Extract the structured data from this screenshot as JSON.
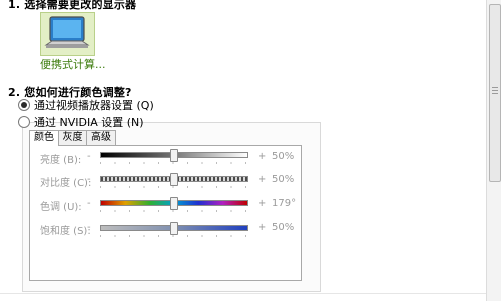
{
  "step1": {
    "label": "1. 选择需要更改的显示器"
  },
  "display": {
    "caption": "便携式计算..."
  },
  "step2": {
    "label": "2. 您如何进行颜色调整?"
  },
  "radios": [
    {
      "label": "通过视频播放器设置 (Q)",
      "checked": true
    },
    {
      "label": "通过 NVIDIA 设置 (N)",
      "checked": false
    }
  ],
  "tabs": [
    "颜色",
    "灰度",
    "高级"
  ],
  "sliders": [
    {
      "label": "亮度 (B):",
      "minus": "-",
      "plus": "+",
      "value_text": "50%",
      "position": 0.5
    },
    {
      "label": "对比度 (C):",
      "minus": "-",
      "plus": "+",
      "value_text": "50%",
      "position": 0.5
    },
    {
      "label": "色调 (U):",
      "minus": "-",
      "plus": "+",
      "value_text": "179°",
      "position": 0.5
    },
    {
      "label": "饱和度 (S):",
      "minus": "-",
      "plus": "+",
      "value_text": "50%",
      "position": 0.5
    }
  ],
  "colors": {
    "accent": "#3a7a0a",
    "disabled_text": "#9a9a9a"
  }
}
